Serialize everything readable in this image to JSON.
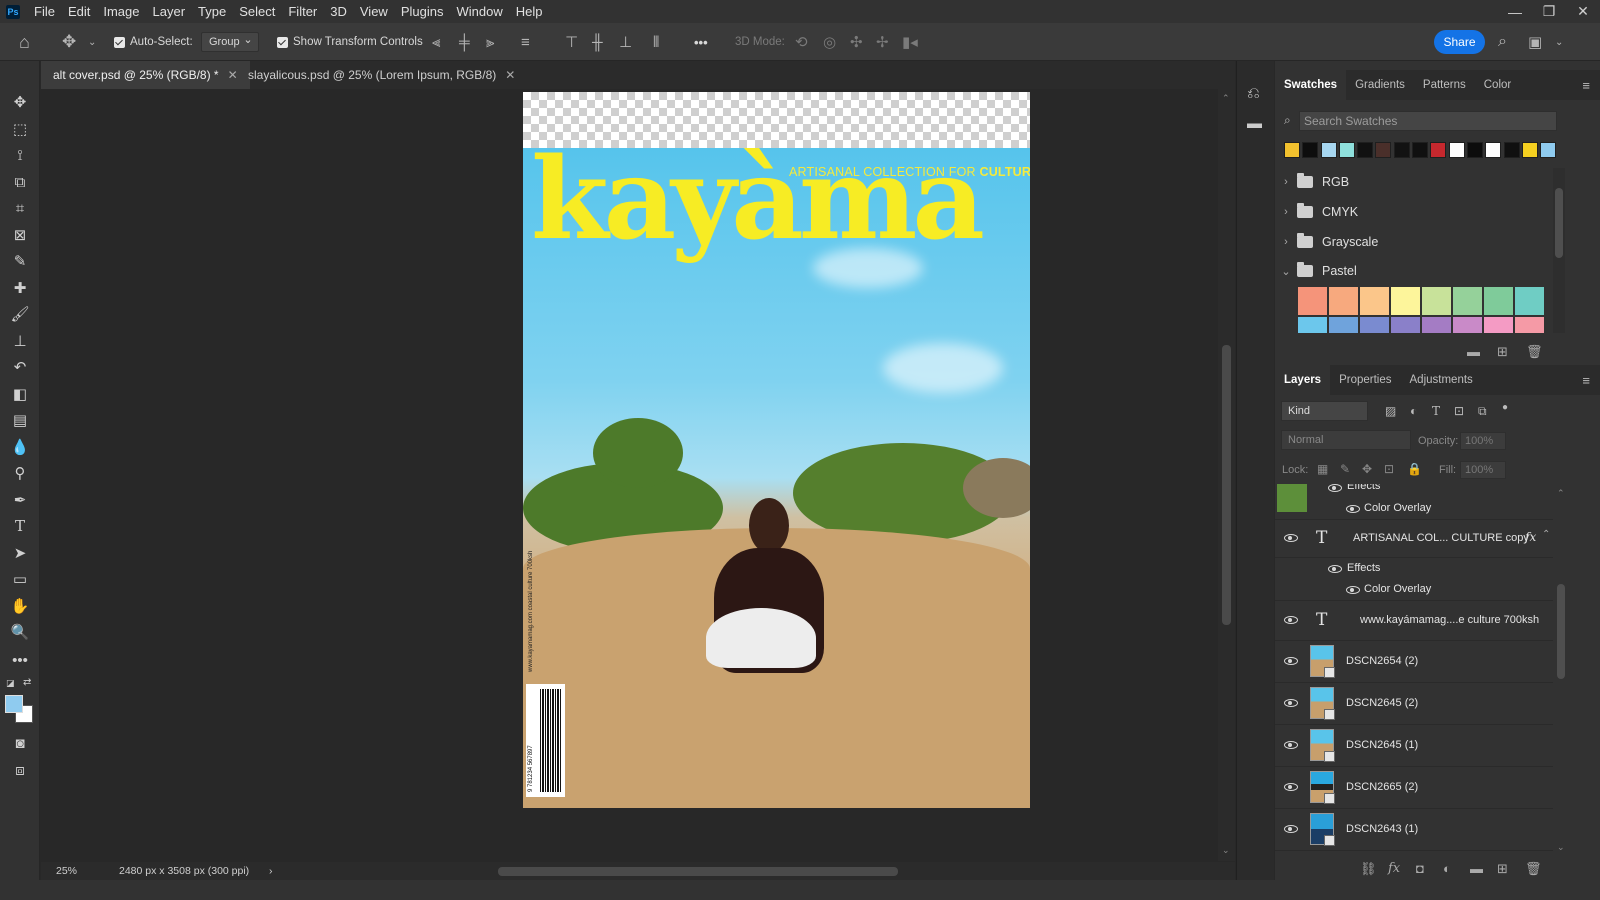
{
  "app": {
    "logo": "Ps"
  },
  "menu": [
    "File",
    "Edit",
    "Image",
    "Layer",
    "Type",
    "Select",
    "Filter",
    "3D",
    "View",
    "Plugins",
    "Window",
    "Help"
  ],
  "window_controls": [
    "—",
    "❐",
    "✕"
  ],
  "options": {
    "auto_select_label": "Auto-Select:",
    "auto_select_value": "Group",
    "show_transform_label": "Show Transform Controls",
    "mode_3d_label": "3D Mode:",
    "more": "•••",
    "share_label": "Share"
  },
  "tabs": [
    {
      "label": "alt cover.psd @ 25% (RGB/8) *",
      "close": "✕"
    },
    {
      "label": "slayalicous.psd @ 25% (Lorem Ipsum, RGB/8)",
      "close": "✕"
    }
  ],
  "document": {
    "tagline_pre": "ARTISANAL COLLECTION FOR ",
    "tagline_bold": "CULTURE",
    "masthead": "kayàma",
    "spine_text": "www.kayamamag.com coastal culture 700ksh",
    "barcode_number": "9 781234 567897"
  },
  "status": {
    "zoom": "25%",
    "doc_size": "2480 px x 3508 px (300 ppi)",
    "arrow": "›"
  },
  "swatches_panel": {
    "tabs": [
      "Swatches",
      "Gradients",
      "Patterns",
      "Color"
    ],
    "search_placeholder": "Search Swatches",
    "recent": [
      "#f2c12e",
      "#0d0d0d",
      "#a6d6f0",
      "#8fe0dc",
      "#111111",
      "#4a2f2a",
      "#121212",
      "#101010",
      "#c6282e",
      "#ffffff",
      "#0c0c0c",
      "#ffffff",
      "#101010",
      "#f5d020",
      "#8fcbef"
    ],
    "groups": [
      {
        "name": "RGB",
        "chev": "›"
      },
      {
        "name": "CMYK",
        "chev": "›"
      },
      {
        "name": "Grayscale",
        "chev": "›"
      },
      {
        "name": "Pastel",
        "chev": "⌄"
      }
    ],
    "pastel": [
      "#f5947a",
      "#f7a97e",
      "#fbc68a",
      "#fdf59b",
      "#c8e29a",
      "#95d19a",
      "#7fcb9a",
      "#6fcdc4",
      "#6cc7ec",
      "#6fa3dc",
      "#7a8bd0",
      "#8a80c9",
      "#a47cc4",
      "#c98ac8",
      "#f49bc4",
      "#f59aa6"
    ]
  },
  "layers_panel": {
    "tabs": [
      "Layers",
      "Properties",
      "Adjustments"
    ],
    "kind_label": "Kind",
    "blend_mode": "Normal",
    "opacity_label": "Opacity:",
    "opacity_value": "100%",
    "lock_label": "Lock:",
    "fill_label": "Fill:",
    "fill_value": "100%",
    "rows": [
      {
        "kind": "effects-sub",
        "label": "Effects"
      },
      {
        "kind": "effect",
        "label": "Color Overlay"
      },
      {
        "kind": "text",
        "label": "ARTISANAL COL... CULTURE copy",
        "fx": "fx"
      },
      {
        "kind": "effects-sub",
        "label": "Effects"
      },
      {
        "kind": "effect",
        "label": "Color Overlay"
      },
      {
        "kind": "text",
        "label": "www.kayámamag....e culture 700ksh"
      },
      {
        "kind": "image",
        "label": "DSCN2654 (2)"
      },
      {
        "kind": "image",
        "label": "DSCN2645 (2)"
      },
      {
        "kind": "image",
        "label": "DSCN2645 (1)"
      },
      {
        "kind": "image",
        "label": "DSCN2665 (2)"
      },
      {
        "kind": "image",
        "label": "DSCN2643 (1)"
      }
    ]
  }
}
